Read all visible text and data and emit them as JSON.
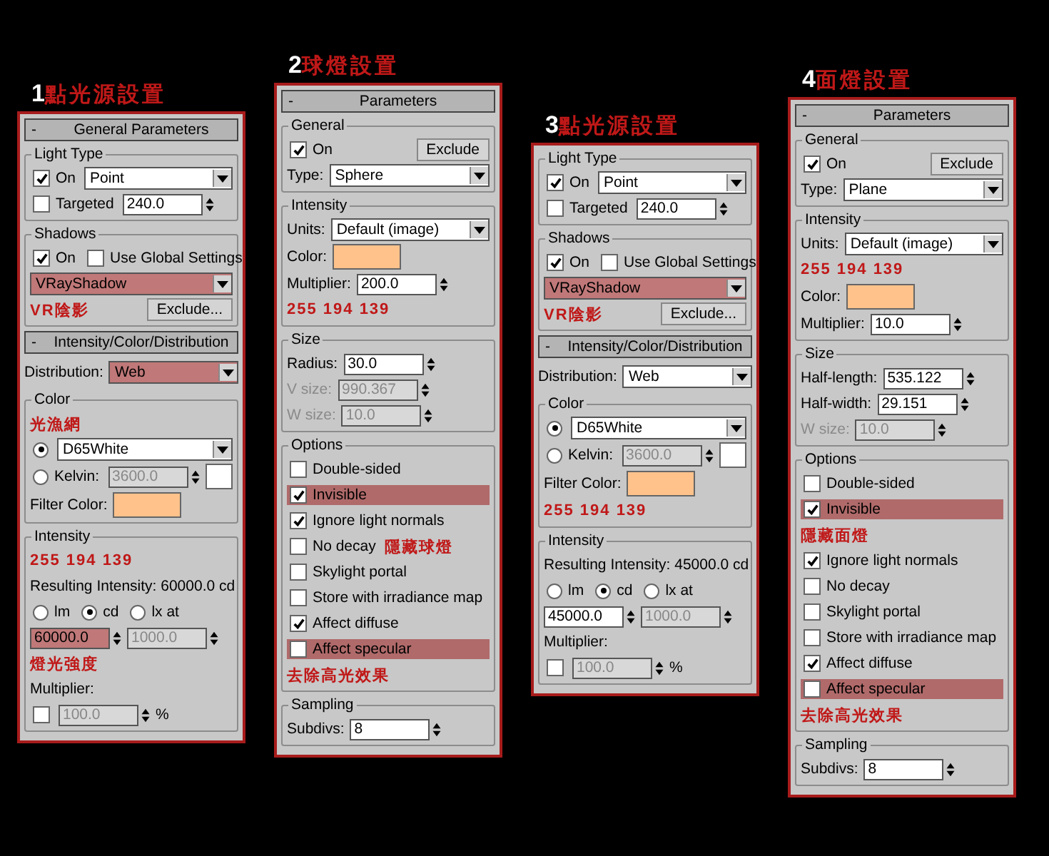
{
  "panels": [
    {
      "number": "1",
      "title": "點光源設置",
      "sections": [
        {
          "kind": "rollout",
          "sign": "-",
          "label": "General Parameters"
        },
        {
          "kind": "group",
          "label": "Light Type",
          "rows": [
            {
              "items": [
                {
                  "kind": "check",
                  "label": "On",
                  "checked": true
                },
                {
                  "kind": "dropdown",
                  "value": "Point"
                }
              ]
            },
            {
              "items": [
                {
                  "kind": "check",
                  "label": "Targeted",
                  "checked": false
                },
                {
                  "kind": "spinner",
                  "value": "240.0"
                }
              ]
            }
          ]
        },
        {
          "kind": "group",
          "label": "Shadows",
          "rows": [
            {
              "items": [
                {
                  "kind": "check",
                  "label": "On",
                  "checked": true
                },
                {
                  "kind": "check",
                  "label": "Use Global Settings",
                  "checked": false
                }
              ]
            },
            {
              "items": [
                {
                  "kind": "dropdown",
                  "value": "VRayShadow",
                  "highlighted": true
                }
              ]
            },
            {
              "items": [
                {
                  "kind": "note",
                  "text": "VR陰影"
                },
                {
                  "kind": "button",
                  "label": "Exclude..."
                }
              ]
            }
          ]
        },
        {
          "kind": "rollout",
          "sign": "-",
          "label": "Intensity/Color/Distribution"
        },
        {
          "kind": "rows",
          "rows": [
            {
              "items": [
                {
                  "kind": "label",
                  "text": "Distribution:"
                },
                {
                  "kind": "dropdown",
                  "value": "Web",
                  "highlighted": true
                }
              ]
            }
          ]
        },
        {
          "kind": "group",
          "label": "Color",
          "rows": [
            {
              "items": [
                {
                  "kind": "note",
                  "text": "光漁網"
                }
              ]
            },
            {
              "items": [
                {
                  "kind": "radio",
                  "selected": true
                },
                {
                  "kind": "dropdown",
                  "value": "D65White"
                }
              ]
            },
            {
              "items": [
                {
                  "kind": "radio",
                  "label": "Kelvin:",
                  "selected": false
                },
                {
                  "kind": "spinner",
                  "value": "3600.0",
                  "disabled": true
                },
                {
                  "kind": "swatch",
                  "color": "#ffffff"
                }
              ]
            },
            {
              "items": [
                {
                  "kind": "label",
                  "text": "Filter Color:"
                },
                {
                  "kind": "swatch",
                  "color": "#ffc28b"
                }
              ]
            }
          ]
        },
        {
          "kind": "group",
          "label": "Intensity",
          "rows": [
            {
              "items": [
                {
                  "kind": "note",
                  "text": "255 194 139"
                }
              ]
            },
            {
              "items": [
                {
                  "kind": "label",
                  "text": "Resulting Intensity: 60000.0 cd"
                }
              ]
            },
            {
              "items": [
                {
                  "kind": "radio",
                  "label": "lm",
                  "selected": false
                },
                {
                  "kind": "radio",
                  "label": "cd",
                  "selected": true
                },
                {
                  "kind": "radio",
                  "label": "lx at",
                  "selected": false
                }
              ]
            },
            {
              "items": [
                {
                  "kind": "spinner",
                  "value": "60000.0",
                  "highlighted": true
                },
                {
                  "kind": "spinner",
                  "value": "1000.0",
                  "disabled": true
                }
              ]
            },
            {
              "items": [
                {
                  "kind": "note",
                  "text": "燈光強度"
                }
              ]
            },
            {
              "items": [
                {
                  "kind": "label",
                  "text": "Multiplier:"
                }
              ]
            },
            {
              "items": [
                {
                  "kind": "check",
                  "checked": false
                },
                {
                  "kind": "spinner",
                  "value": "100.0",
                  "disabled": true
                },
                {
                  "kind": "label",
                  "text": "%"
                }
              ]
            }
          ]
        }
      ]
    },
    {
      "number": "2",
      "title": "球燈設置",
      "sections": [
        {
          "kind": "rollout",
          "sign": "-",
          "label": "Parameters"
        },
        {
          "kind": "group",
          "label": "General",
          "rows": [
            {
              "items": [
                {
                  "kind": "check",
                  "label": "On",
                  "checked": true
                },
                {
                  "kind": "button",
                  "label": "Exclude"
                }
              ]
            },
            {
              "items": [
                {
                  "kind": "label",
                  "text": "Type:"
                },
                {
                  "kind": "dropdown",
                  "value": "Sphere"
                }
              ]
            }
          ]
        },
        {
          "kind": "group",
          "label": "Intensity",
          "rows": [
            {
              "items": [
                {
                  "kind": "label",
                  "text": "Units:"
                },
                {
                  "kind": "dropdown",
                  "value": "Default (image)"
                }
              ]
            },
            {
              "items": [
                {
                  "kind": "label",
                  "text": "Color:"
                },
                {
                  "kind": "swatch",
                  "color": "#ffc28b"
                }
              ]
            },
            {
              "items": [
                {
                  "kind": "label",
                  "text": "Multiplier:"
                },
                {
                  "kind": "spinner",
                  "value": "200.0"
                }
              ]
            },
            {
              "items": [
                {
                  "kind": "note",
                  "text": "255 194 139"
                }
              ]
            }
          ]
        },
        {
          "kind": "group",
          "label": "Size",
          "rows": [
            {
              "items": [
                {
                  "kind": "label",
                  "text": "Radius:"
                },
                {
                  "kind": "spinner",
                  "value": "30.0"
                }
              ]
            },
            {
              "items": [
                {
                  "kind": "label",
                  "text": "V size:",
                  "disabled": true
                },
                {
                  "kind": "spinner",
                  "value": "990.367",
                  "disabled": true
                }
              ]
            },
            {
              "items": [
                {
                  "kind": "label",
                  "text": "W size:",
                  "disabled": true
                },
                {
                  "kind": "spinner",
                  "value": "10.0",
                  "disabled": true
                }
              ]
            }
          ]
        },
        {
          "kind": "group",
          "label": "Options",
          "rows": [
            {
              "items": [
                {
                  "kind": "check",
                  "label": "Double-sided",
                  "checked": false
                }
              ]
            },
            {
              "items": [
                {
                  "kind": "check",
                  "label": "Invisible",
                  "checked": true,
                  "highlighted": true
                }
              ]
            },
            {
              "items": [
                {
                  "kind": "check",
                  "label": "Ignore light normals",
                  "checked": true
                }
              ]
            },
            {
              "items": [
                {
                  "kind": "check",
                  "label": "No decay",
                  "checked": false
                },
                {
                  "kind": "note",
                  "text": "隱藏球燈"
                }
              ]
            },
            {
              "items": [
                {
                  "kind": "check",
                  "label": "Skylight portal",
                  "checked": false
                }
              ]
            },
            {
              "items": [
                {
                  "kind": "check",
                  "label": "Store with irradiance map",
                  "checked": false
                }
              ]
            },
            {
              "items": [
                {
                  "kind": "check",
                  "label": "Affect diffuse",
                  "checked": true
                }
              ]
            },
            {
              "items": [
                {
                  "kind": "check",
                  "label": "Affect specular",
                  "checked": false,
                  "highlighted": true
                }
              ]
            },
            {
              "items": [
                {
                  "kind": "note",
                  "text": "去除高光效果"
                }
              ]
            }
          ]
        },
        {
          "kind": "group",
          "label": "Sampling",
          "rows": [
            {
              "items": [
                {
                  "kind": "label",
                  "text": "Subdivs:"
                },
                {
                  "kind": "spinner",
                  "value": "8"
                }
              ]
            }
          ]
        }
      ]
    },
    {
      "number": "3",
      "title": "點光源設置",
      "sections": [
        {
          "kind": "group",
          "label": "Light Type",
          "rows": [
            {
              "items": [
                {
                  "kind": "check",
                  "label": "On",
                  "checked": true
                },
                {
                  "kind": "dropdown",
                  "value": "Point"
                }
              ]
            },
            {
              "items": [
                {
                  "kind": "check",
                  "label": "Targeted",
                  "checked": false
                },
                {
                  "kind": "spinner",
                  "value": "240.0"
                }
              ]
            }
          ]
        },
        {
          "kind": "group",
          "label": "Shadows",
          "rows": [
            {
              "items": [
                {
                  "kind": "check",
                  "label": "On",
                  "checked": true
                },
                {
                  "kind": "check",
                  "label": "Use Global Settings",
                  "checked": false
                }
              ]
            },
            {
              "items": [
                {
                  "kind": "dropdown",
                  "value": "VRayShadow",
                  "highlighted": true
                }
              ]
            },
            {
              "items": [
                {
                  "kind": "note",
                  "text": "VR陰影"
                },
                {
                  "kind": "button",
                  "label": "Exclude..."
                }
              ]
            }
          ]
        },
        {
          "kind": "rollout",
          "sign": "-",
          "label": "Intensity/Color/Distribution"
        },
        {
          "kind": "rows",
          "rows": [
            {
              "items": [
                {
                  "kind": "label",
                  "text": "Distribution:"
                },
                {
                  "kind": "dropdown",
                  "value": "Web"
                }
              ]
            }
          ]
        },
        {
          "kind": "group",
          "label": "Color",
          "rows": [
            {
              "items": [
                {
                  "kind": "radio",
                  "selected": true
                },
                {
                  "kind": "dropdown",
                  "value": "D65White"
                }
              ]
            },
            {
              "items": [
                {
                  "kind": "radio",
                  "label": "Kelvin:",
                  "selected": false
                },
                {
                  "kind": "spinner",
                  "value": "3600.0",
                  "disabled": true
                },
                {
                  "kind": "swatch",
                  "color": "#ffffff"
                }
              ]
            },
            {
              "items": [
                {
                  "kind": "label",
                  "text": "Filter Color:"
                },
                {
                  "kind": "swatch",
                  "color": "#ffc28b"
                }
              ]
            },
            {
              "items": [
                {
                  "kind": "note",
                  "text": "255 194 139"
                }
              ]
            }
          ]
        },
        {
          "kind": "group",
          "label": "Intensity",
          "rows": [
            {
              "items": [
                {
                  "kind": "label",
                  "text": "Resulting Intensity: 45000.0 cd"
                }
              ]
            },
            {
              "items": [
                {
                  "kind": "radio",
                  "label": "lm",
                  "selected": false
                },
                {
                  "kind": "radio",
                  "label": "cd",
                  "selected": true
                },
                {
                  "kind": "radio",
                  "label": "lx at",
                  "selected": false
                }
              ]
            },
            {
              "items": [
                {
                  "kind": "spinner",
                  "value": "45000.0"
                },
                {
                  "kind": "spinner",
                  "value": "1000.0",
                  "disabled": true
                }
              ]
            },
            {
              "items": [
                {
                  "kind": "label",
                  "text": "Multiplier:"
                }
              ]
            },
            {
              "items": [
                {
                  "kind": "check",
                  "checked": false
                },
                {
                  "kind": "spinner",
                  "value": "100.0",
                  "disabled": true
                },
                {
                  "kind": "label",
                  "text": "%"
                }
              ]
            }
          ]
        }
      ]
    },
    {
      "number": "4",
      "title": "面燈設置",
      "sections": [
        {
          "kind": "rollout",
          "sign": "-",
          "label": "Parameters"
        },
        {
          "kind": "group",
          "label": "General",
          "rows": [
            {
              "items": [
                {
                  "kind": "check",
                  "label": "On",
                  "checked": true
                },
                {
                  "kind": "button",
                  "label": "Exclude"
                }
              ]
            },
            {
              "items": [
                {
                  "kind": "label",
                  "text": "Type:"
                },
                {
                  "kind": "dropdown",
                  "value": "Plane"
                }
              ]
            }
          ]
        },
        {
          "kind": "group",
          "label": "Intensity",
          "rows": [
            {
              "items": [
                {
                  "kind": "label",
                  "text": "Units:"
                },
                {
                  "kind": "dropdown",
                  "value": "Default (image)"
                }
              ]
            },
            {
              "items": [
                {
                  "kind": "note",
                  "text": "255 194 139"
                }
              ]
            },
            {
              "items": [
                {
                  "kind": "label",
                  "text": "Color:"
                },
                {
                  "kind": "swatch",
                  "color": "#ffc28b"
                }
              ]
            },
            {
              "items": [
                {
                  "kind": "label",
                  "text": "Multiplier:"
                },
                {
                  "kind": "spinner",
                  "value": "10.0"
                }
              ]
            }
          ]
        },
        {
          "kind": "group",
          "label": "Size",
          "rows": [
            {
              "items": [
                {
                  "kind": "label",
                  "text": "Half-length:"
                },
                {
                  "kind": "spinner",
                  "value": "535.122"
                }
              ]
            },
            {
              "items": [
                {
                  "kind": "label",
                  "text": "Half-width:"
                },
                {
                  "kind": "spinner",
                  "value": "29.151"
                }
              ]
            },
            {
              "items": [
                {
                  "kind": "label",
                  "text": "W size:",
                  "disabled": true
                },
                {
                  "kind": "spinner",
                  "value": "10.0",
                  "disabled": true
                }
              ]
            }
          ]
        },
        {
          "kind": "group",
          "label": "Options",
          "rows": [
            {
              "items": [
                {
                  "kind": "check",
                  "label": "Double-sided",
                  "checked": false
                }
              ]
            },
            {
              "items": [
                {
                  "kind": "check",
                  "label": "Invisible",
                  "checked": true,
                  "highlighted": true
                }
              ]
            },
            {
              "items": [
                {
                  "kind": "note",
                  "text": "隱藏面燈"
                }
              ]
            },
            {
              "items": [
                {
                  "kind": "check",
                  "label": "Ignore light normals",
                  "checked": true
                }
              ]
            },
            {
              "items": [
                {
                  "kind": "check",
                  "label": "No decay",
                  "checked": false
                }
              ]
            },
            {
              "items": [
                {
                  "kind": "check",
                  "label": "Skylight portal",
                  "checked": false
                }
              ]
            },
            {
              "items": [
                {
                  "kind": "check",
                  "label": "Store with irradiance map",
                  "checked": false
                }
              ]
            },
            {
              "items": [
                {
                  "kind": "check",
                  "label": "Affect diffuse",
                  "checked": true
                }
              ]
            },
            {
              "items": [
                {
                  "kind": "check",
                  "label": "Affect specular",
                  "checked": false,
                  "highlighted": true
                }
              ]
            },
            {
              "items": [
                {
                  "kind": "note",
                  "text": "去除高光效果"
                }
              ]
            }
          ]
        },
        {
          "kind": "group",
          "label": "Sampling",
          "rows": [
            {
              "items": [
                {
                  "kind": "label",
                  "text": "Subdivs:"
                },
                {
                  "kind": "spinner",
                  "value": "8"
                }
              ]
            }
          ]
        }
      ]
    }
  ]
}
